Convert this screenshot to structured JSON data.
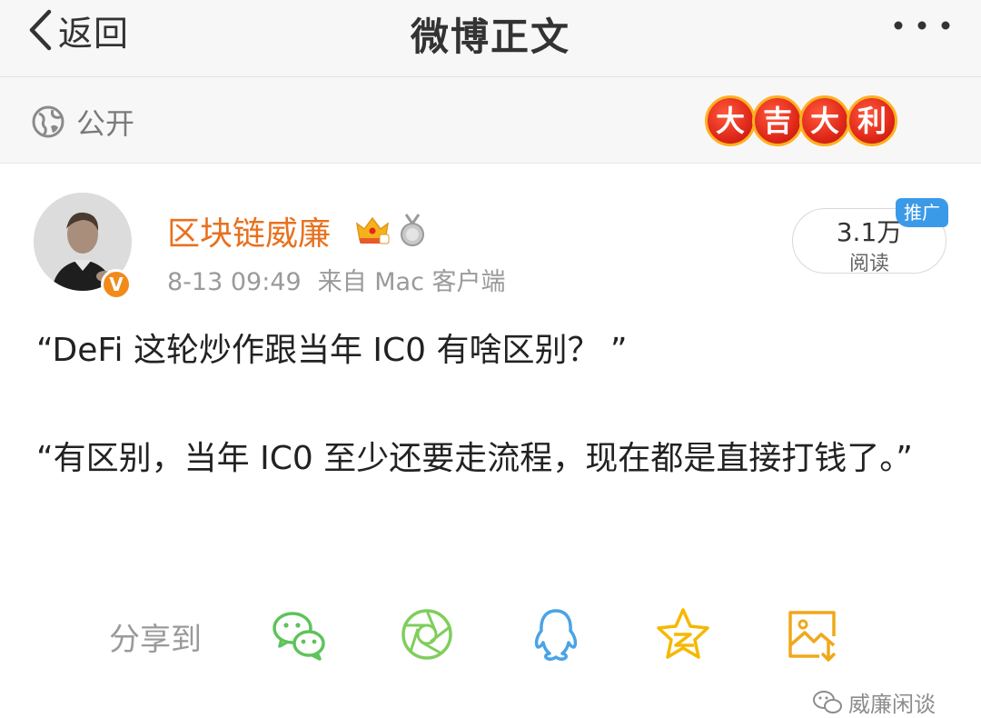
{
  "nav": {
    "back_label": "返回",
    "title": "微博正文"
  },
  "visibility": {
    "label": "公开",
    "lucky_chars": [
      "大",
      "吉",
      "大",
      "利"
    ]
  },
  "post": {
    "author": "区块链威廉",
    "time": "8-13 09:49",
    "source": "来自 Mac 客户端",
    "reads_count": "3.1万",
    "reads_label": "阅读",
    "promo_badge": "推广",
    "paragraphs": [
      "“DeFi 这轮炒作跟当年 IC0 有啥区别？ ”",
      "“有区别，当年 IC0 至少还要走流程，现在都是直接打钱了。”"
    ]
  },
  "share": {
    "label": "分享到",
    "targets": [
      "wechat-icon",
      "moments-icon",
      "qq-icon",
      "qzone-icon",
      "save-image-icon"
    ]
  },
  "watermark": "威廉闲谈",
  "colors": {
    "username": "#e8711f",
    "wechat": "#5ec35a",
    "moments": "#7fce5b",
    "qq": "#4aa3e6",
    "qzone": "#f5b800",
    "save": "#f0a81b",
    "promo": "#3b9ae8"
  }
}
